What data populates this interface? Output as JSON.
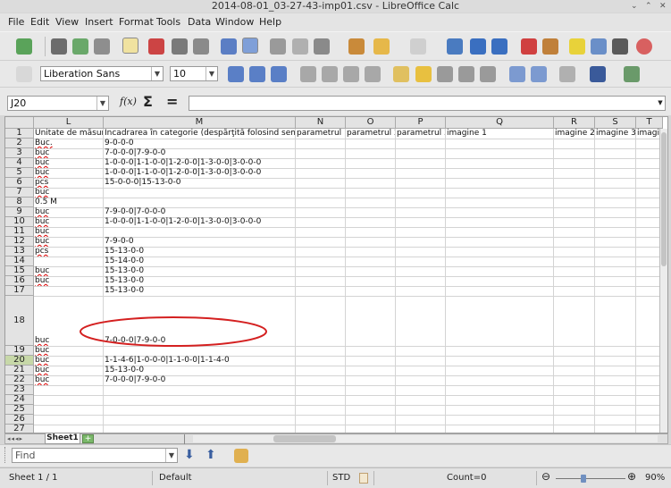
{
  "window": {
    "title": "2014-08-01_03-27-43-imp01.csv - LibreOffice Calc",
    "minimize": "⌄",
    "maximize": "⌃",
    "close": "✕"
  },
  "menu": [
    "File",
    "Edit",
    "View",
    "Insert",
    "Format",
    "Tools",
    "Data",
    "Window",
    "Help"
  ],
  "formatting": {
    "font_name": "Liberation Sans",
    "font_size": "10"
  },
  "formula_bar": {
    "name_box": "J20",
    "fx": "f(x)",
    "sum": "Σ",
    "equals": "=",
    "content": ""
  },
  "columns": [
    "L",
    "M",
    "N",
    "O",
    "P",
    "Q",
    "R",
    "S",
    "T"
  ],
  "rows": [
    {
      "n": "1",
      "l": "Unitate de măsură",
      "m": "Încadrarea în categorie (despărţită folosind semnul \"|\"",
      "n_": "parametrul 1",
      "o": "parametrul 2",
      "p": "parametrul 3",
      "q": "imagine 1",
      "r": "imagine 2",
      "s": "imagine 3",
      "t": "imagin"
    },
    {
      "n": "2",
      "l": "Buc.",
      "m": "9-0-0-0"
    },
    {
      "n": "3",
      "l": "buc",
      "m": "7-0-0-0|7-9-0-0"
    },
    {
      "n": "4",
      "l": "buc",
      "m": "1-0-0-0|1-1-0-0|1-2-0-0|1-3-0-0|3-0-0-0"
    },
    {
      "n": "5",
      "l": "buc",
      "m": "1-0-0-0|1-1-0-0|1-2-0-0|1-3-0-0|3-0-0-0"
    },
    {
      "n": "6",
      "l": "pcs",
      "m": "15-0-0-0|15-13-0-0"
    },
    {
      "n": "7",
      "l": "buc",
      "m": ""
    },
    {
      "n": "8",
      "l": "0.5 M",
      "m": ""
    },
    {
      "n": "9",
      "l": "buc",
      "m": "7-9-0-0|7-0-0-0"
    },
    {
      "n": "10",
      "l": "buc",
      "m": "1-0-0-0|1-1-0-0|1-2-0-0|1-3-0-0|3-0-0-0"
    },
    {
      "n": "11",
      "l": "buc",
      "m": ""
    },
    {
      "n": "12",
      "l": "buc",
      "m": "7-9-0-0"
    },
    {
      "n": "13",
      "l": "pcs",
      "m": "15-13-0-0"
    },
    {
      "n": "14",
      "l": "",
      "m": "15-14-0-0"
    },
    {
      "n": "15",
      "l": "buc",
      "m": "15-13-0-0"
    },
    {
      "n": "16",
      "l": "buc",
      "m": "15-13-0-0"
    },
    {
      "n": "17",
      "l": "",
      "m": "15-13-0-0"
    },
    {
      "n": "18",
      "l": "buc",
      "m": "7-0-0-0|7-9-0-0"
    },
    {
      "n": "19",
      "l": "buc",
      "m": ""
    },
    {
      "n": "20",
      "l": "buc",
      "m": "1-1-4-6|1-0-0-0|1-1-0-0|1-1-4-0"
    },
    {
      "n": "21",
      "l": "buc",
      "m": "15-13-0-0"
    },
    {
      "n": "22",
      "l": "buc",
      "m": "7-0-0-0|7-9-0-0"
    },
    {
      "n": "23",
      "l": "",
      "m": ""
    },
    {
      "n": "24",
      "l": "",
      "m": ""
    },
    {
      "n": "25",
      "l": "",
      "m": ""
    },
    {
      "n": "26",
      "l": "",
      "m": ""
    },
    {
      "n": "27",
      "l": "",
      "m": ""
    }
  ],
  "sheet_tab": "Sheet1",
  "find": {
    "placeholder": "Find"
  },
  "status": {
    "sheet": "Sheet 1 / 1",
    "style": "Default",
    "mode": "STD",
    "count": "Count=0",
    "zoom": "90%"
  },
  "accent_active_row": "#c7d8a8",
  "annotation_color": "#d42020"
}
